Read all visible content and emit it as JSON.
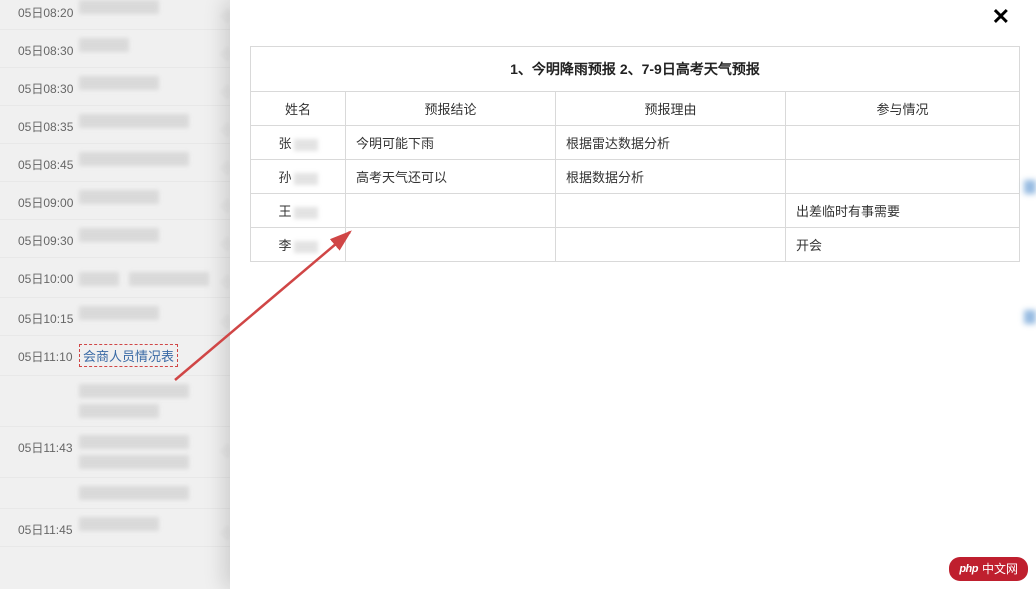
{
  "timeline": {
    "rows": [
      {
        "time": "05日08:20"
      },
      {
        "time": "05日08:30"
      },
      {
        "time": "05日08:30"
      },
      {
        "time": "05日08:35"
      },
      {
        "time": "05日08:45"
      },
      {
        "time": "05日09:00"
      },
      {
        "time": "05日09:30"
      },
      {
        "time": "05日10:00"
      },
      {
        "time": "05日10:15"
      },
      {
        "time": "05日11:10",
        "link_label": "会商人员情况表"
      },
      {
        "time": ""
      },
      {
        "time": "05日11:43"
      },
      {
        "time": ""
      },
      {
        "time": "05日11:45"
      }
    ]
  },
  "modal": {
    "close_symbol": "✕",
    "title": "1、今明降雨预报 2、7-9日高考天气预报",
    "headers": {
      "name": "姓名",
      "conclusion": "预报结论",
      "reason": "预报理由",
      "participation": "参与情况"
    },
    "rows": [
      {
        "name_prefix": "张",
        "conclusion": "今明可能下雨",
        "reason": "根据雷达数据分析",
        "participation": ""
      },
      {
        "name_prefix": "孙",
        "conclusion": "高考天气还可以",
        "reason": "根据数据分析",
        "participation": ""
      },
      {
        "name_prefix": "王",
        "conclusion": "",
        "reason": "",
        "participation": "出差临时有事需要"
      },
      {
        "name_prefix": "李",
        "conclusion": "",
        "reason": "",
        "participation": "开会"
      }
    ]
  },
  "logo": {
    "php": "php",
    "text": "中文网"
  },
  "colors": {
    "arrow": "#d04646",
    "modal_border": "#d9d9d9",
    "logo_bg": "#bf1f2e"
  }
}
